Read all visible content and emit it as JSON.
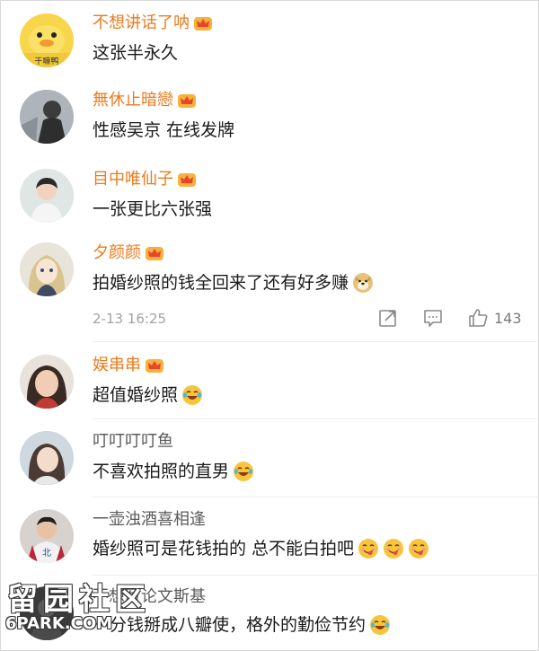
{
  "comments": [
    {
      "name": "不想讲话了呐",
      "vip": true,
      "text": "这张半永久",
      "emoji_count": 0,
      "avatar": "yellow-duck-avatar",
      "avatar_caption": "干嘛鸭"
    },
    {
      "name": "無休止暗戀",
      "vip": true,
      "text": "性感吴京 在线发牌",
      "emoji_count": 0,
      "avatar": "dark-photo-avatar"
    },
    {
      "name": "目中唯仙子",
      "vip": true,
      "text": "一张更比六张强",
      "emoji_count": 0,
      "avatar": "young-man-avatar"
    },
    {
      "name": "夕颜颜",
      "vip": true,
      "text": "拍婚纱照的钱全回来了还有好多赚",
      "emoji": "doge-emoji",
      "emoji_count": 1,
      "avatar": "anime-girl-avatar",
      "timestamp": "2-13 16:25",
      "like_count": "143"
    },
    {
      "name": "娱串串",
      "vip": true,
      "text": "超值婚纱照",
      "emoji": "laugh-cry-emoji",
      "emoji_count": 1,
      "avatar": "girl-red-avatar"
    },
    {
      "name": "叮叮叮叮鱼",
      "vip": false,
      "text": "不喜欢拍照的直男",
      "emoji": "laugh-cry-emoji",
      "emoji_count": 1,
      "avatar": "girl-soft-avatar"
    },
    {
      "name": "一壶浊酒喜相逢",
      "vip": false,
      "text": "婚纱照可是花钱拍的 总不能白拍吧",
      "emoji": "yum-emoji",
      "emoji_count": 3,
      "avatar": "man-jersey-avatar"
    },
    {
      "name": "不想写论文斯基",
      "vip": false,
      "text": "一分钱掰成八瓣使，格外的勤俭节约",
      "emoji": "laugh-cry-emoji",
      "emoji_count": 1,
      "avatar": "dark-avatar"
    }
  ],
  "watermark": {
    "cn": "留园社区",
    "en": "6PARK.COM"
  },
  "colors": {
    "vip_name": "#ea7b1e",
    "plain_name": "#5b5b5b",
    "meta": "#a2a2a2"
  }
}
